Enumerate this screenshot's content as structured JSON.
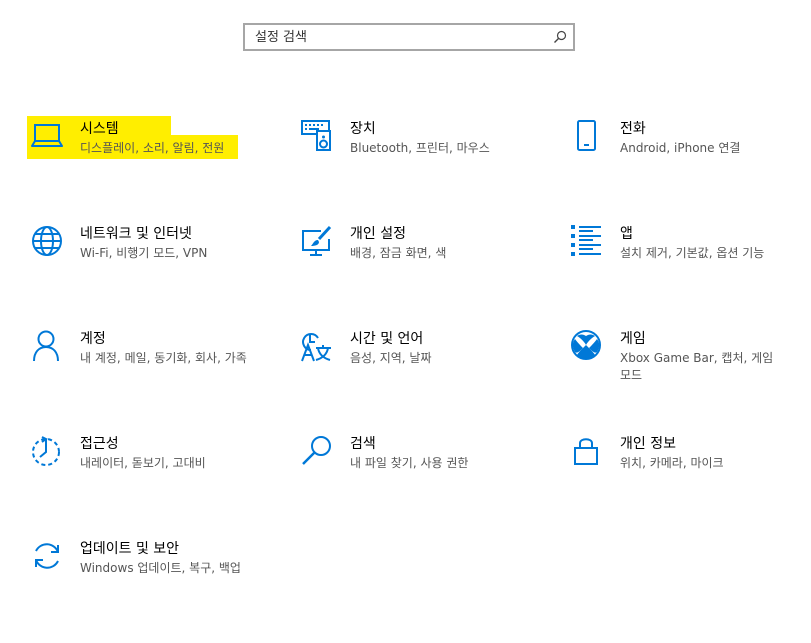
{
  "search": {
    "placeholder": "설정 검색"
  },
  "colors": {
    "accent": "#0078d7",
    "highlight": "#ffee00"
  },
  "tiles": [
    {
      "title": "시스템",
      "desc": "디스플레이, 소리, 알림, 전원",
      "icon": "laptop-icon"
    },
    {
      "title": "장치",
      "desc": "Bluetooth, 프린터, 마우스",
      "icon": "devices-icon"
    },
    {
      "title": "전화",
      "desc": "Android, iPhone 연결",
      "icon": "phone-icon"
    },
    {
      "title": "네트워크 및 인터넷",
      "desc": "Wi-Fi, 비행기 모드, VPN",
      "icon": "globe-icon"
    },
    {
      "title": "개인 설정",
      "desc": "배경, 잠금 화면, 색",
      "icon": "personalization-icon"
    },
    {
      "title": "앱",
      "desc": "설치 제거, 기본값, 옵션 기능",
      "icon": "apps-list-icon"
    },
    {
      "title": "계정",
      "desc": "내 계정, 메일, 동기화, 회사, 가족",
      "icon": "person-icon"
    },
    {
      "title": "시간 및 언어",
      "desc": "음성, 지역, 날짜",
      "icon": "time-language-icon"
    },
    {
      "title": "게임",
      "desc": "Xbox Game Bar, 캡처, 게임 모드",
      "icon": "xbox-icon"
    },
    {
      "title": "접근성",
      "desc": "내레이터, 돋보기, 고대비",
      "icon": "ease-of-access-icon"
    },
    {
      "title": "검색",
      "desc": "내 파일 찾기, 사용 권한",
      "icon": "search-icon"
    },
    {
      "title": "개인 정보",
      "desc": "위치, 카메라, 마이크",
      "icon": "lock-icon"
    },
    {
      "title": "업데이트 및 보안",
      "desc": "Windows 업데이트, 복구, 백업",
      "icon": "sync-icon"
    }
  ]
}
